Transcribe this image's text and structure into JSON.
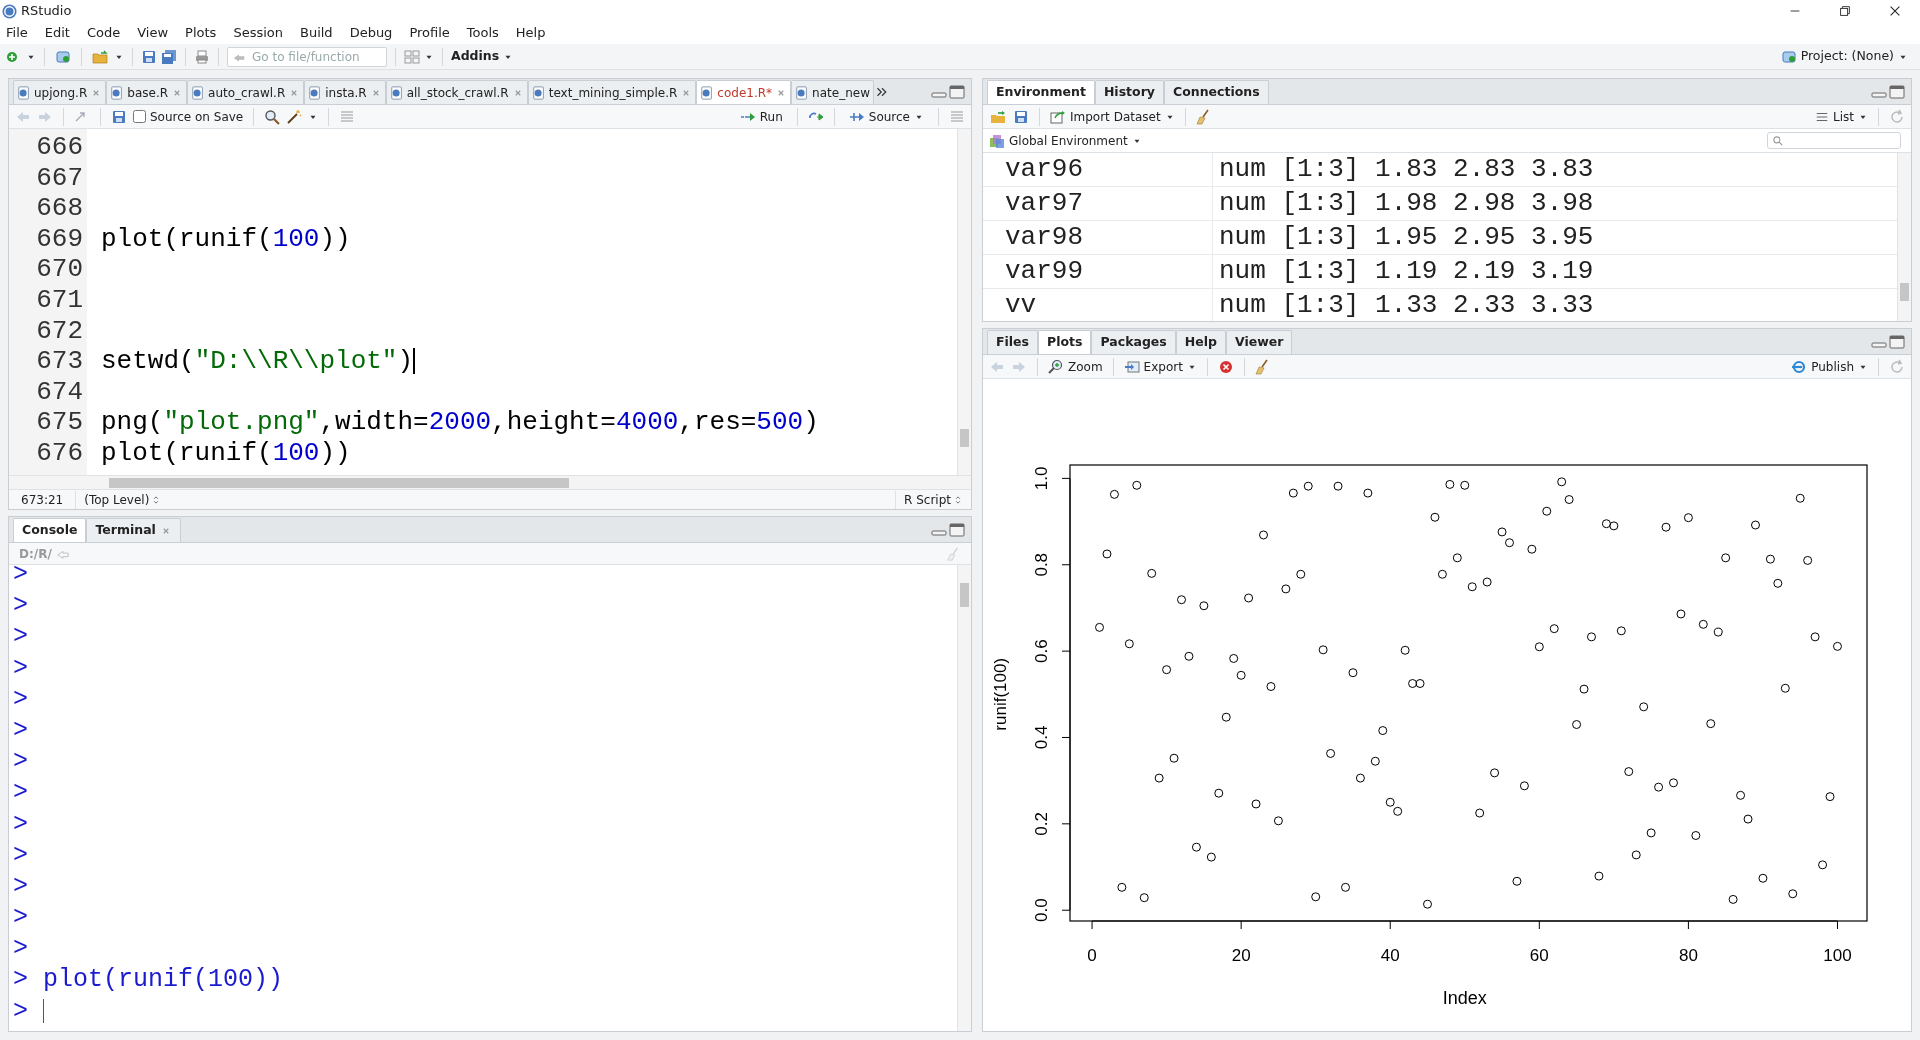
{
  "window": {
    "title": "RStudio"
  },
  "menu": [
    "File",
    "Edit",
    "Code",
    "View",
    "Plots",
    "Session",
    "Build",
    "Debug",
    "Profile",
    "Tools",
    "Help"
  ],
  "toolbar": {
    "goto_placeholder": "Go to file/function",
    "addins": "Addins",
    "project": "Project: (None)"
  },
  "editor": {
    "tabs": [
      {
        "label": "upjong.R",
        "selected": false
      },
      {
        "label": "base.R",
        "selected": false
      },
      {
        "label": "auto_crawl.R",
        "selected": false
      },
      {
        "label": "insta.R",
        "selected": false
      },
      {
        "label": "all_stock_crawl.R",
        "selected": false
      },
      {
        "label": "text_mining_simple.R",
        "selected": false
      },
      {
        "label": "code1.R*",
        "selected": true
      },
      {
        "label": "nate_new",
        "selected": false
      }
    ],
    "source_on_save": {
      "label": "Source on Save",
      "checked": false
    },
    "run": "Run",
    "source": "Source",
    "lines": [
      {
        "number": "666",
        "cursor": false
      },
      {
        "number": "667",
        "cursor": false
      },
      {
        "number": "668",
        "cursor": false
      },
      {
        "number": "669",
        "cursor": false,
        "tokens": [
          {
            "text": "plot(runif(",
            "kind": "plain"
          },
          {
            "text": "100",
            "kind": "number"
          },
          {
            "text": "))",
            "kind": "plain"
          }
        ]
      },
      {
        "number": "670",
        "cursor": false
      },
      {
        "number": "671",
        "cursor": false
      },
      {
        "number": "672",
        "cursor": false
      },
      {
        "number": "673",
        "cursor": true,
        "tokens": [
          {
            "text": "setwd(",
            "kind": "plain"
          },
          {
            "text": "\"D:\\\\R\\\\plot\"",
            "kind": "string"
          },
          {
            "text": ")",
            "kind": "plain"
          }
        ]
      },
      {
        "number": "674",
        "cursor": false
      },
      {
        "number": "675",
        "cursor": false,
        "tokens": [
          {
            "text": "png(",
            "kind": "plain"
          },
          {
            "text": "\"plot.png\"",
            "kind": "string"
          },
          {
            "text": ",width=",
            "kind": "plain"
          },
          {
            "text": "2000",
            "kind": "number"
          },
          {
            "text": ",height=",
            "kind": "plain"
          },
          {
            "text": "4000",
            "kind": "number"
          },
          {
            "text": ",res=",
            "kind": "plain"
          },
          {
            "text": "500",
            "kind": "number"
          },
          {
            "text": ")",
            "kind": "plain"
          }
        ]
      },
      {
        "number": "676",
        "cursor": false,
        "tokens": [
          {
            "text": "plot(runif(",
            "kind": "plain"
          },
          {
            "text": "100",
            "kind": "number"
          },
          {
            "text": "))",
            "kind": "plain"
          }
        ]
      }
    ],
    "status": {
      "position": "673:21",
      "scope": "(Top Level)",
      "file_type": "R Script"
    }
  },
  "console": {
    "tabs": [
      {
        "label": "Console",
        "selected": true,
        "closable": false
      },
      {
        "label": "Terminal",
        "selected": false,
        "closable": true
      }
    ],
    "path": "D:/R/",
    "lines": [
      {
        "prompt": ">",
        "cursor": false
      },
      {
        "prompt": ">",
        "cursor": false
      },
      {
        "prompt": ">",
        "cursor": false
      },
      {
        "prompt": ">",
        "cursor": false
      },
      {
        "prompt": ">",
        "cursor": false
      },
      {
        "prompt": ">",
        "cursor": false
      },
      {
        "prompt": ">",
        "cursor": false
      },
      {
        "prompt": ">",
        "cursor": false
      },
      {
        "prompt": ">",
        "cursor": false
      },
      {
        "prompt": ">",
        "cursor": false
      },
      {
        "prompt": ">",
        "cursor": false
      },
      {
        "prompt": ">",
        "cursor": false
      },
      {
        "prompt": ">",
        "cursor": false
      },
      {
        "prompt": ">",
        "command": "plot(runif(100))",
        "cursor": false
      },
      {
        "prompt": ">",
        "cursor": true
      }
    ]
  },
  "environment": {
    "tabs": [
      {
        "label": "Environment",
        "selected": true
      },
      {
        "label": "History",
        "selected": false
      },
      {
        "label": "Connections",
        "selected": false
      }
    ],
    "import": "Import Dataset",
    "view": "List",
    "scope": "Global Environment",
    "rows": [
      {
        "name": "var96",
        "value": "num [1:3] 1.83 2.83 3.83"
      },
      {
        "name": "var97",
        "value": "num [1:3] 1.98 2.98 3.98"
      },
      {
        "name": "var98",
        "value": "num [1:3] 1.95 2.95 3.95"
      },
      {
        "name": "var99",
        "value": "num [1:3] 1.19 2.19 3.19"
      },
      {
        "name": "vv",
        "value": "num [1:3] 1.33 2.33 3.33"
      }
    ]
  },
  "plots_pane": {
    "tabs": [
      {
        "label": "Files",
        "selected": false
      },
      {
        "label": "Plots",
        "selected": true
      },
      {
        "label": "Packages",
        "selected": false
      },
      {
        "label": "Help",
        "selected": false
      },
      {
        "label": "Viewer",
        "selected": false
      }
    ],
    "zoom": "Zoom",
    "export": "Export",
    "publish": "Publish",
    "chart_data": {
      "type": "scatter",
      "xlabel": "Index",
      "ylabel": "runif(100)",
      "x": [
        1,
        2,
        3,
        4,
        5,
        6,
        7,
        8,
        9,
        10,
        11,
        12,
        13,
        14,
        15,
        16,
        17,
        18,
        19,
        20,
        21,
        22,
        23,
        24,
        25,
        26,
        27,
        28,
        29,
        30,
        31,
        32,
        33,
        34,
        35,
        36,
        37,
        38,
        39,
        40,
        41,
        42,
        43,
        44,
        45,
        46,
        47,
        48,
        49,
        50,
        51,
        52,
        53,
        54,
        55,
        56,
        57,
        58,
        59,
        60,
        61,
        62,
        63,
        64,
        65,
        66,
        67,
        68,
        69,
        70,
        71,
        72,
        73,
        74,
        75,
        76,
        77,
        78,
        79,
        80,
        81,
        82,
        83,
        84,
        85,
        86,
        87,
        88,
        89,
        90,
        91,
        92,
        93,
        94,
        95,
        96,
        97,
        98,
        99,
        100
      ],
      "values": [
        0.655,
        0.825,
        0.963,
        0.053,
        0.617,
        0.984,
        0.029,
        0.78,
        0.306,
        0.557,
        0.352,
        0.719,
        0.588,
        0.146,
        0.705,
        0.123,
        0.271,
        0.447,
        0.583,
        0.544,
        0.723,
        0.246,
        0.869,
        0.518,
        0.207,
        0.744,
        0.966,
        0.778,
        0.982,
        0.031,
        0.603,
        0.363,
        0.982,
        0.053,
        0.55,
        0.306,
        0.966,
        0.345,
        0.416,
        0.25,
        0.229,
        0.602,
        0.525,
        0.525,
        0.014,
        0.91,
        0.778,
        0.986,
        0.816,
        0.984,
        0.749,
        0.225,
        0.76,
        0.318,
        0.876,
        0.851,
        0.067,
        0.288,
        0.836,
        0.61,
        0.924,
        0.652,
        0.992,
        0.951,
        0.43,
        0.512,
        0.633,
        0.079,
        0.895,
        0.89,
        0.647,
        0.321,
        0.128,
        0.471,
        0.179,
        0.285,
        0.887,
        0.295,
        0.686,
        0.909,
        0.173,
        0.662,
        0.432,
        0.644,
        0.816,
        0.025,
        0.266,
        0.211,
        0.892,
        0.074,
        0.813,
        0.757,
        0.514,
        0.038,
        0.954,
        0.81,
        0.633,
        0.105,
        0.263,
        0.611
      ],
      "xlim": [
        -2.96,
        103.96
      ],
      "ylim": [
        -0.025,
        1.031
      ],
      "xticks": [
        0,
        20,
        40,
        60,
        80,
        100
      ],
      "yticks": [
        {
          "value": 0,
          "label": "0.0"
        },
        {
          "value": 0.2,
          "label": "0.2"
        },
        {
          "value": 0.4,
          "label": "0.4"
        },
        {
          "value": 0.6,
          "label": "0.6"
        },
        {
          "value": 0.8,
          "label": "0.8"
        },
        {
          "value": 1,
          "label": "1.0"
        }
      ]
    }
  }
}
